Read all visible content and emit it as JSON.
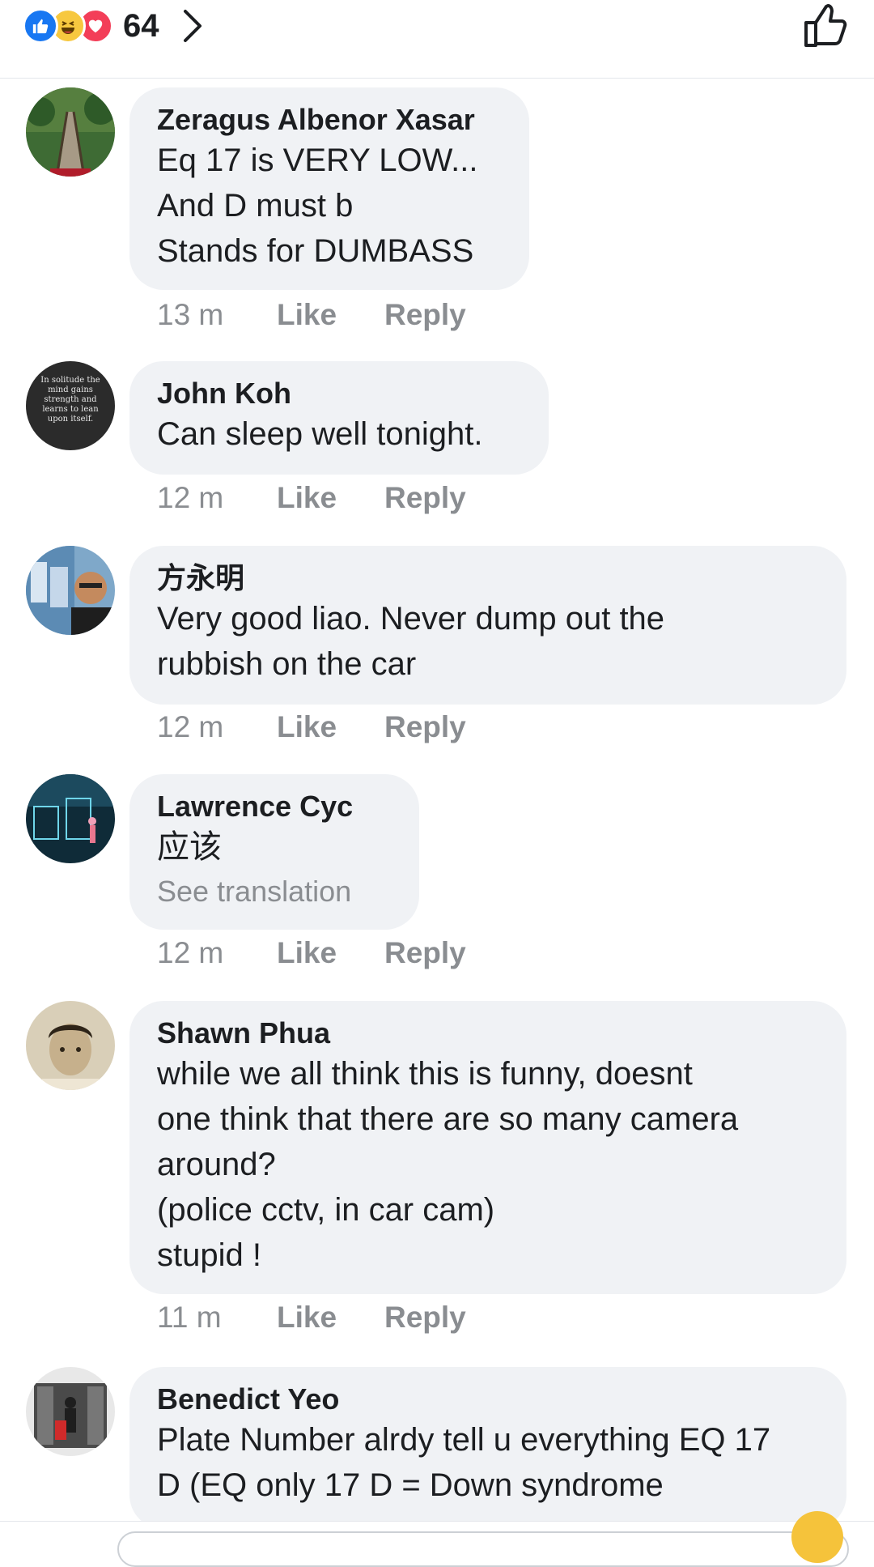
{
  "reactions_bar": {
    "count": "64",
    "reaction_types": [
      "like-reaction",
      "haha-reaction",
      "love-reaction"
    ],
    "colors": {
      "like": "#1877f2",
      "haha": "#f7c83f",
      "love": "#f33e58"
    }
  },
  "comments": [
    {
      "author": "Zeragus Albenor Xasar",
      "lines": [
        "Eq 17 is VERY LOW...",
        "And D must b",
        "Stands for DUMBASS"
      ],
      "time": "13 m",
      "like_label": "Like",
      "reply_label": "Reply"
    },
    {
      "author": "John Koh",
      "lines": [
        "Can sleep well tonight."
      ],
      "time": "12 m",
      "like_label": "Like",
      "reply_label": "Reply",
      "avatar_text": [
        "In solitude the",
        "mind gains",
        "strength and",
        "learns to lean",
        "upon itself."
      ]
    },
    {
      "author": "方永明",
      "lines": [
        "Very good liao. Never dump out the",
        "rubbish on the car"
      ],
      "time": "12 m",
      "like_label": "Like",
      "reply_label": "Reply"
    },
    {
      "author": "Lawrence Cyc",
      "lines": [
        "应该"
      ],
      "see_translation": "See translation",
      "time": "12 m",
      "like_label": "Like",
      "reply_label": "Reply"
    },
    {
      "author": "Shawn Phua",
      "lines": [
        "while we all think this is funny,  doesnt",
        "one think that there are so many camera",
        "around?",
        "(police cctv, in car cam)",
        "stupid !"
      ],
      "time": "11 m",
      "like_label": "Like",
      "reply_label": "Reply"
    },
    {
      "author": "Benedict Yeo",
      "lines": [
        "Plate Number alrdy tell u everything EQ 17",
        "D (EQ only 17 D = Down syndrome"
      ]
    }
  ],
  "colors": {
    "bubble_bg": "#f0f2f5",
    "meta_text": "#8a8d91",
    "primary_text": "#1c1e21"
  }
}
